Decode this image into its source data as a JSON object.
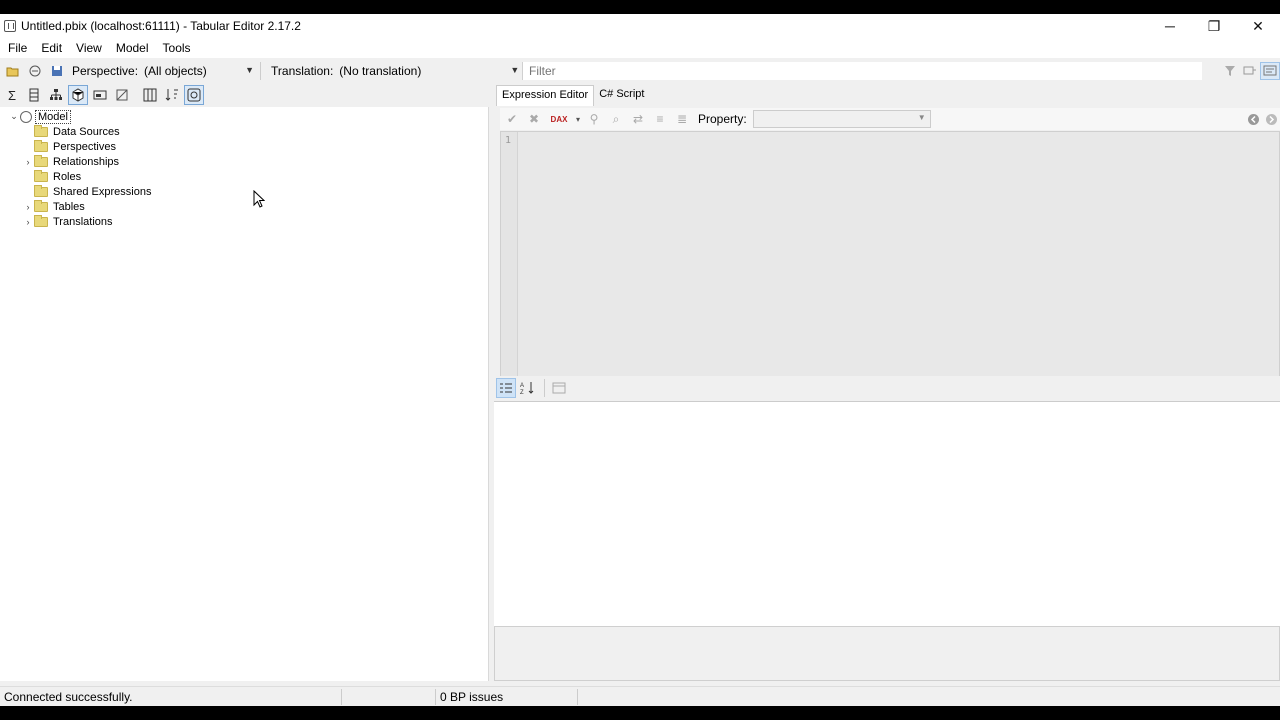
{
  "window": {
    "title": "Untitled.pbix (localhost:61111) - Tabular Editor 2.17.2",
    "controls": {
      "minimize": "─",
      "restore": "❐",
      "close": "✕"
    }
  },
  "menu": [
    "File",
    "Edit",
    "View",
    "Model",
    "Tools"
  ],
  "toolbar": {
    "perspective_label": "Perspective:",
    "perspective_value": "(All objects)",
    "translation_label": "Translation:",
    "translation_value": "(No translation)",
    "filter_placeholder": "Filter"
  },
  "tree": {
    "root": "Model",
    "items": [
      {
        "label": "Data Sources",
        "expandable": false
      },
      {
        "label": "Perspectives",
        "expandable": false
      },
      {
        "label": "Relationships",
        "expandable": true
      },
      {
        "label": "Roles",
        "expandable": false
      },
      {
        "label": "Shared Expressions",
        "expandable": false
      },
      {
        "label": "Tables",
        "expandable": true
      },
      {
        "label": "Translations",
        "expandable": true
      }
    ]
  },
  "right_tabs": [
    "Expression Editor",
    "C# Script"
  ],
  "editor": {
    "property_label": "Property:",
    "property_value": "",
    "line_number": "1",
    "dax_badge": "DAX"
  },
  "status": {
    "message": "Connected successfully.",
    "bp_issues": "0 BP issues"
  },
  "colors": {
    "folder": "#e8d87a",
    "active_toggle": "#dbe9f7"
  }
}
